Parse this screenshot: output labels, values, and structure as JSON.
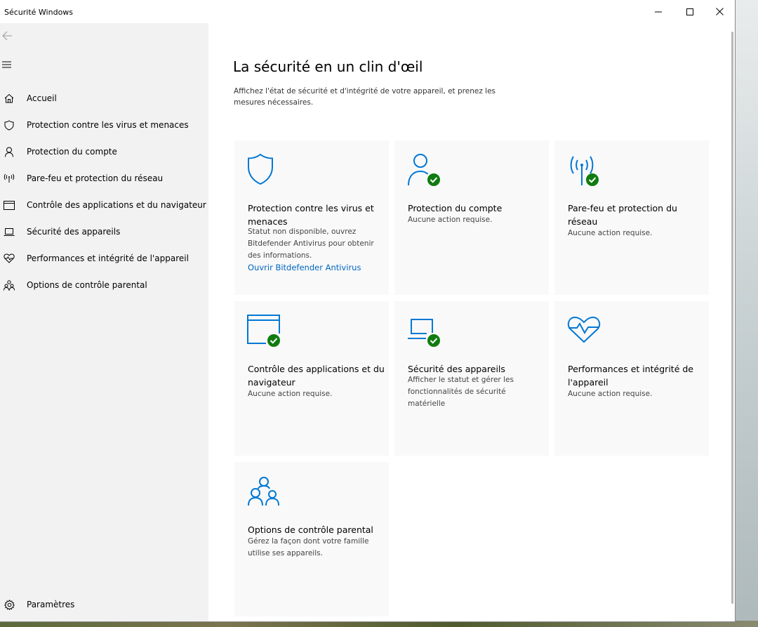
{
  "window": {
    "title": "Sécurité Windows",
    "controls": {
      "minimize": "minimize-icon",
      "maximize": "maximize-icon",
      "close": "close-icon"
    }
  },
  "sidebar": {
    "back_icon": "back-arrow-icon",
    "menu_icon": "hamburger-menu-icon",
    "items": [
      {
        "label": "Accueil",
        "icon": "home-icon"
      },
      {
        "label": "Protection contre les virus et menaces",
        "icon": "shield-icon"
      },
      {
        "label": "Protection du compte",
        "icon": "person-icon"
      },
      {
        "label": "Pare-feu et protection du réseau",
        "icon": "antenna-icon"
      },
      {
        "label": "Contrôle des applications et du navigateur",
        "icon": "browser-window-icon"
      },
      {
        "label": "Sécurité des appareils",
        "icon": "laptop-icon"
      },
      {
        "label": "Performances et intégrité de l'appareil",
        "icon": "heart-pulse-icon"
      },
      {
        "label": "Options de contrôle parental",
        "icon": "family-icon"
      }
    ],
    "settings": {
      "label": "Paramètres",
      "icon": "gear-icon"
    }
  },
  "main": {
    "title": "La sécurité en un clin d'œil",
    "description": "Affichez l'état de sécurité et d'intégrité de votre appareil, et prenez les mesures nécessaires.",
    "tiles": [
      {
        "title": "Protection contre les virus et menaces",
        "desc": "Statut non disponible, ouvrez Bitdefender Antivirus pour obtenir des informations.",
        "link": "Ouvrir Bitdefender Antivirus",
        "icon": "shield-icon",
        "status": "none"
      },
      {
        "title": "Protection du compte",
        "desc": "Aucune action requise.",
        "icon": "person-icon",
        "status": "ok"
      },
      {
        "title": "Pare-feu et protection du réseau",
        "desc": "Aucune action requise.",
        "icon": "antenna-icon",
        "status": "ok"
      },
      {
        "title": "Contrôle des applications et du navigateur",
        "desc": "Aucune action requise.",
        "icon": "browser-window-icon",
        "status": "ok"
      },
      {
        "title": "Sécurité des appareils",
        "desc": "Afficher le statut et gérer les fonctionnalités de sécurité matérielle",
        "icon": "laptop-icon",
        "status": "ok"
      },
      {
        "title": "Performances et intégrité de l'appareil",
        "desc": "Aucune action requise.",
        "icon": "heart-pulse-icon",
        "status": "none"
      },
      {
        "title": "Options de contrôle parental",
        "desc": "Gérez la façon dont votre famille utilise ses appareils.",
        "icon": "family-icon",
        "status": "none"
      }
    ]
  },
  "colors": {
    "accent": "#0067c0",
    "icon_blue": "#0078d4",
    "status_ok": "#107c10",
    "sidebar_bg": "#f2f2f2",
    "tile_bg": "#f9f9f9"
  }
}
